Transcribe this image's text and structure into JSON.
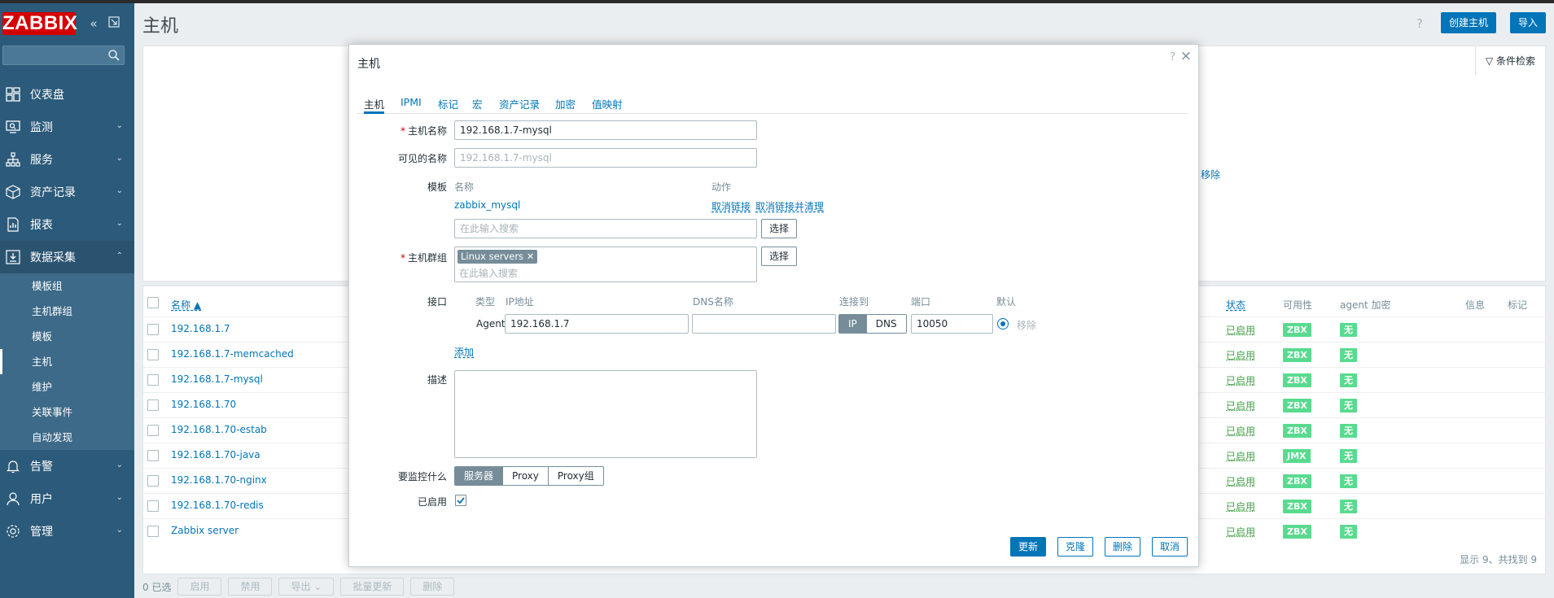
{
  "brand": {
    "logo": "ZABBIX"
  },
  "sidebar": {
    "search_placeholder": "",
    "items": [
      {
        "label": "仪表盘",
        "icon": "dashboard-icon"
      },
      {
        "label": "监测",
        "icon": "monitoring-icon"
      },
      {
        "label": "服务",
        "icon": "services-icon"
      },
      {
        "label": "资产记录",
        "icon": "inventory-icon"
      },
      {
        "label": "报表",
        "icon": "reports-icon"
      },
      {
        "label": "数据采集",
        "icon": "data-collection-icon"
      },
      {
        "label": "告警",
        "icon": "alerts-icon"
      },
      {
        "label": "用户",
        "icon": "users-icon"
      },
      {
        "label": "管理",
        "icon": "administration-icon"
      }
    ],
    "sub_items": [
      "模板组",
      "主机群组",
      "模板",
      "主机",
      "维护",
      "关联事件",
      "自动发现"
    ],
    "active_sub": "主机"
  },
  "header": {
    "title": "主机",
    "help": "?",
    "create_button": "创建主机",
    "import_button": "导入"
  },
  "filter": {
    "label": "条件检索",
    "remove_link": "移除"
  },
  "table": {
    "columns": {
      "name": "名称 ▲",
      "status": "状态",
      "availability": "可用性",
      "agent_encryption": "agent 加密",
      "info": "信息",
      "tags": "标记"
    },
    "rows": [
      {
        "name": "192.168.1.7",
        "status": "已启用",
        "avail": "ZBX",
        "enc": "无"
      },
      {
        "name": "192.168.1.7-memcached",
        "status": "已启用",
        "avail": "ZBX",
        "enc": "无"
      },
      {
        "name": "192.168.1.7-mysql",
        "status": "已启用",
        "avail": "ZBX",
        "enc": "无"
      },
      {
        "name": "192.168.1.70",
        "status": "已启用",
        "avail": "ZBX",
        "enc": "无"
      },
      {
        "name": "192.168.1.70-estab",
        "status": "已启用",
        "avail": "ZBX",
        "enc": "无"
      },
      {
        "name": "192.168.1.70-java",
        "status": "已启用",
        "avail": "JMX",
        "enc": "无"
      },
      {
        "name": "192.168.1.70-nginx",
        "status": "已启用",
        "avail": "ZBX",
        "enc": "无"
      },
      {
        "name": "192.168.1.70-redis",
        "status": "已启用",
        "avail": "ZBX",
        "enc": "无"
      },
      {
        "name": "Zabbix server",
        "status": "已启用",
        "avail": "ZBX",
        "enc": "无"
      }
    ],
    "footer": "显示 9、共找到 9"
  },
  "bottom_bar": {
    "selected": "0 已选",
    "buttons": [
      "启用",
      "禁用",
      "导出",
      "批量更新",
      "删除"
    ]
  },
  "dialog": {
    "title": "主机",
    "help": "?",
    "close": "×",
    "tabs": [
      "主机",
      "IPMI",
      "标记",
      "宏",
      "资产记录",
      "加密",
      "值映射"
    ],
    "active_tab": "主机",
    "fields": {
      "host_name_label": "主机名称",
      "host_name_value": "192.168.1.7-mysql",
      "visible_name_label": "可见的名称",
      "visible_name_placeholder": "192.168.1.7-mysql",
      "templates_label": "模板",
      "templates_col_name": "名称",
      "templates_col_action": "动作",
      "template_name": "zabbix_mysql",
      "unlink": "取消链接",
      "unlink_clear": "取消链接并清理",
      "template_search_placeholder": "在此输入搜索",
      "select_button": "选择",
      "groups_label": "主机群组",
      "group_chip": "Linux servers",
      "group_search_placeholder": "在此输入搜索",
      "interfaces_label": "接口",
      "if_col_type": "类型",
      "if_col_ip": "IP地址",
      "if_col_dns": "DNS名称",
      "if_col_connect": "连接到",
      "if_col_port": "端口",
      "if_col_default": "默认",
      "if_type": "Agent",
      "if_ip": "192.168.1.7",
      "if_dns": "",
      "connect_ip": "IP",
      "connect_dns": "DNS",
      "if_port": "10050",
      "if_remove": "移除",
      "add_link": "添加",
      "description_label": "描述",
      "monitored_by_label": "要监控什么",
      "monitored_by_options": [
        "服务器",
        "Proxy",
        "Proxy组"
      ],
      "monitored_by_selected": "服务器",
      "enabled_label": "已启用",
      "enabled": true
    },
    "buttons": {
      "update": "更新",
      "clone": "克隆",
      "delete": "删除",
      "cancel": "取消"
    }
  }
}
